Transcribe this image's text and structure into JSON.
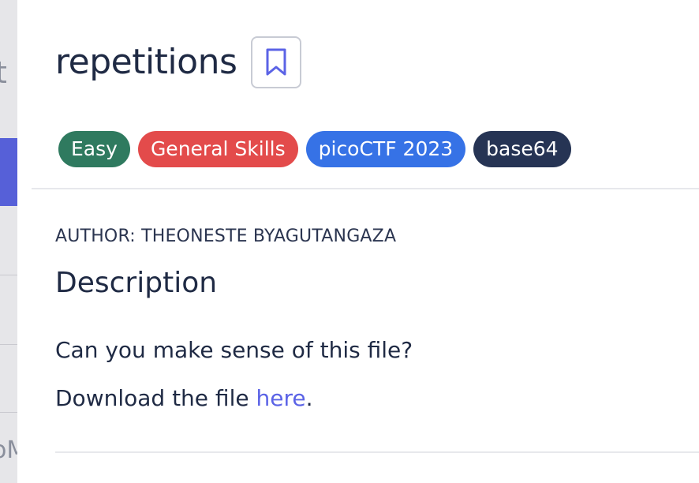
{
  "background": {
    "glyph_top": "t",
    "glyph_bottom": "oM"
  },
  "challenge": {
    "title": "repetitions",
    "bookmark_icon": "bookmark-icon",
    "tags": [
      {
        "label": "Easy",
        "color": "#2f7a5f"
      },
      {
        "label": "General Skills",
        "color": "#e34b4b"
      },
      {
        "label": "picoCTF 2023",
        "color": "#3672e6"
      },
      {
        "label": "base64",
        "color": "#263454"
      }
    ],
    "author": "AUTHOR: THEONESTE BYAGUTANGAZA",
    "description_heading": "Description",
    "description_line1": "Can you make sense of this file?",
    "download_prefix": "Download the file ",
    "download_link": "here",
    "download_suffix": "."
  },
  "colors": {
    "link": "#5b63e6",
    "text": "#1f2a44",
    "accent_bg": "#5660d8"
  }
}
